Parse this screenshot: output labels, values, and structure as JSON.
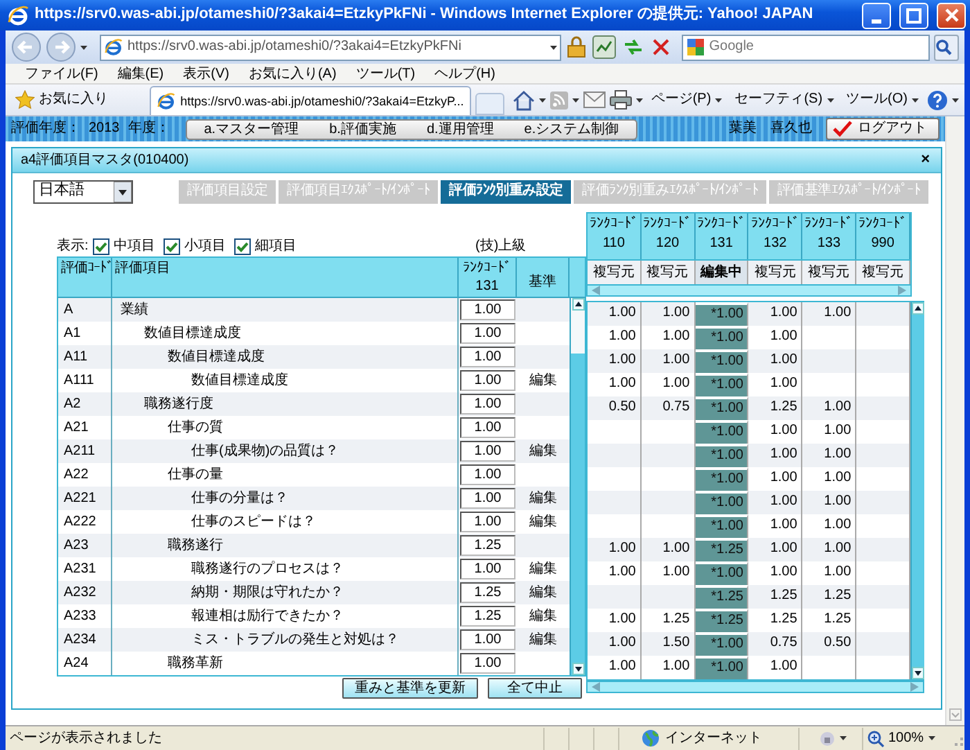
{
  "window": {
    "title": "https://srv0.was-abi.jp/otameshi0/?3akai4=EtzkyPkFNi - Windows Internet Explorer の提供元: Yahoo! JAPAN"
  },
  "address_bar": {
    "url": "https://srv0.was-abi.jp/otameshi0/?3akai4=EtzkyPkFNi"
  },
  "search": {
    "placeholder": "Google"
  },
  "menu": [
    "ファイル(F)",
    "編集(E)",
    "表示(V)",
    "お気に入り(A)",
    "ツール(T)",
    "ヘルプ(H)"
  ],
  "favorites": {
    "label": "お気に入り"
  },
  "browser_tabs": [
    {
      "label": "https://srv0.was-abi.jp/otameshi0/?3akai4=EtzkyP...",
      "selected": true
    }
  ],
  "command_bar": [
    "ページ(P)",
    "セーフティ(S)",
    "ツール(O)"
  ],
  "app_header": {
    "year_label": "評価年度：",
    "year": "2013",
    "year_suffix": "年度：",
    "nav": [
      "a.マスター管理",
      "b.評価実施",
      "d.運用管理",
      "e.システム制御"
    ],
    "user": "葉美　喜久也",
    "logout": "ログアウト"
  },
  "dialog": {
    "title": "a4評価項目マスタ(010400)",
    "close": "×",
    "language": "日本語",
    "tabs": [
      {
        "label": "評価項目設定",
        "selected": false
      },
      {
        "label": "評価項目ｴｸｽﾎﾟｰﾄ/ｲﾝﾎﾟｰﾄ",
        "selected": false
      },
      {
        "label": "評価ﾗﾝｸ別重み設定",
        "selected": true
      },
      {
        "label": "評価ﾗﾝｸ別重みｴｸｽﾎﾟｰﾄ/ｲﾝﾎﾟｰﾄ",
        "selected": false
      },
      {
        "label": "評価基準ｴｸｽﾎﾟｰﾄ/ｲﾝﾎﾟｰﾄ",
        "selected": false
      }
    ],
    "display_label": "表示:",
    "filters": [
      {
        "label": "中項目",
        "checked": true
      },
      {
        "label": "小項目",
        "checked": true
      },
      {
        "label": "細項目",
        "checked": true
      }
    ],
    "grade": "(技)上級",
    "columns": {
      "code": "評価ｺｰﾄﾞ",
      "item": "評価項目",
      "rank_label": "ﾗﾝｸｺｰﾄﾞ",
      "rank": "131",
      "criteria": "基準"
    },
    "rank_columns": [
      {
        "label": "ﾗﾝｸｺｰﾄﾞ",
        "code": "110",
        "status": "複写元",
        "selected": false
      },
      {
        "label": "ﾗﾝｸｺｰﾄﾞ",
        "code": "120",
        "status": "複写元",
        "selected": false
      },
      {
        "label": "ﾗﾝｸｺｰﾄﾞ",
        "code": "131",
        "status": "編集中",
        "selected": true
      },
      {
        "label": "ﾗﾝｸｺｰﾄﾞ",
        "code": "132",
        "status": "複写元",
        "selected": false
      },
      {
        "label": "ﾗﾝｸｺｰﾄﾞ",
        "code": "133",
        "status": "複写元",
        "selected": false
      },
      {
        "label": "ﾗﾝｸｺｰﾄﾞ",
        "code": "990",
        "status": "複写元",
        "selected": false
      }
    ],
    "items": [
      {
        "code": "A",
        "name": "業績",
        "weight": "1.00",
        "values": [
          {
            "kind": "value",
            "value": "1.00"
          },
          {
            "kind": "value",
            "value": "1.00"
          },
          {
            "kind": "value",
            "value": "*1.00"
          },
          {
            "kind": "value",
            "value": "1.00"
          },
          {
            "kind": "value",
            "value": "1.00"
          },
          {
            "kind": "blank"
          }
        ],
        "children": [
          {
            "code": "A1",
            "name": "数値目標達成度",
            "weight": "1.00",
            "values": [
              {
                "kind": "value",
                "value": "1.00"
              },
              {
                "kind": "value",
                "value": "1.00"
              },
              {
                "kind": "value",
                "value": "*1.00"
              },
              {
                "kind": "value",
                "value": "1.00"
              },
              {
                "kind": "blank"
              },
              {
                "kind": "blank"
              }
            ],
            "children": [
              {
                "code": "A11",
                "name": "数値目標達成度",
                "weight": "1.00",
                "values": [
                  {
                    "kind": "value",
                    "value": "1.00"
                  },
                  {
                    "kind": "value",
                    "value": "1.00"
                  },
                  {
                    "kind": "value",
                    "value": "*1.00"
                  },
                  {
                    "kind": "value",
                    "value": "1.00"
                  },
                  {
                    "kind": "blank"
                  },
                  {
                    "kind": "blank"
                  }
                ],
                "children": [
                  {
                    "code": "A111",
                    "name": "数値目標達成度",
                    "weight": "1.00",
                    "criteria": "編集",
                    "values": [
                      {
                        "kind": "value",
                        "value": "1.00"
                      },
                      {
                        "kind": "value",
                        "value": "1.00"
                      },
                      {
                        "kind": "value",
                        "value": "*1.00"
                      },
                      {
                        "kind": "value",
                        "value": "1.00"
                      },
                      {
                        "kind": "blank"
                      },
                      {
                        "kind": "blank"
                      }
                    ]
                  }
                ]
              }
            ]
          },
          {
            "code": "A2",
            "name": "職務遂行度",
            "weight": "1.00",
            "values": [
              {
                "kind": "value",
                "value": "0.50"
              },
              {
                "kind": "value",
                "value": "0.75"
              },
              {
                "kind": "value",
                "value": "*1.00"
              },
              {
                "kind": "value",
                "value": "1.25"
              },
              {
                "kind": "value",
                "value": "1.00"
              },
              {
                "kind": "blank"
              }
            ],
            "children": [
              {
                "code": "A21",
                "name": "仕事の質",
                "weight": "1.00",
                "values": [
                  {
                    "kind": "blank"
                  },
                  {
                    "kind": "blank"
                  },
                  {
                    "kind": "value",
                    "value": "*1.00"
                  },
                  {
                    "kind": "value",
                    "value": "1.00"
                  },
                  {
                    "kind": "value",
                    "value": "1.00"
                  },
                  {
                    "kind": "blank"
                  }
                ],
                "children": [
                  {
                    "code": "A211",
                    "name": "仕事(成果物)の品質は？",
                    "weight": "1.00",
                    "criteria": "編集",
                    "values": [
                      {
                        "kind": "blank"
                      },
                      {
                        "kind": "blank"
                      },
                      {
                        "kind": "value",
                        "value": "*1.00"
                      },
                      {
                        "kind": "value",
                        "value": "1.00"
                      },
                      {
                        "kind": "value",
                        "value": "1.00"
                      },
                      {
                        "kind": "blank"
                      }
                    ]
                  }
                ]
              },
              {
                "code": "A22",
                "name": "仕事の量",
                "weight": "1.00",
                "values": [
                  {
                    "kind": "blank"
                  },
                  {
                    "kind": "blank"
                  },
                  {
                    "kind": "value",
                    "value": "*1.00"
                  },
                  {
                    "kind": "value",
                    "value": "1.00"
                  },
                  {
                    "kind": "value",
                    "value": "1.00"
                  },
                  {
                    "kind": "blank"
                  }
                ],
                "children": [
                  {
                    "code": "A221",
                    "name": "仕事の分量は？",
                    "weight": "1.00",
                    "criteria": "編集",
                    "values": [
                      {
                        "kind": "blank"
                      },
                      {
                        "kind": "blank"
                      },
                      {
                        "kind": "value",
                        "value": "*1.00"
                      },
                      {
                        "kind": "value",
                        "value": "1.00"
                      },
                      {
                        "kind": "value",
                        "value": "1.00"
                      },
                      {
                        "kind": "blank"
                      }
                    ]
                  },
                  {
                    "code": "A222",
                    "name": "仕事のスピードは？",
                    "weight": "1.00",
                    "criteria": "編集",
                    "values": [
                      {
                        "kind": "blank"
                      },
                      {
                        "kind": "blank"
                      },
                      {
                        "kind": "value",
                        "value": "*1.00"
                      },
                      {
                        "kind": "value",
                        "value": "1.00"
                      },
                      {
                        "kind": "value",
                        "value": "1.00"
                      },
                      {
                        "kind": "blank"
                      }
                    ]
                  }
                ]
              },
              {
                "code": "A23",
                "name": "職務遂行",
                "weight": "1.25",
                "values": [
                  {
                    "kind": "value",
                    "value": "1.00"
                  },
                  {
                    "kind": "value",
                    "value": "1.00"
                  },
                  {
                    "kind": "value",
                    "value": "*1.25"
                  },
                  {
                    "kind": "value",
                    "value": "1.00"
                  },
                  {
                    "kind": "value",
                    "value": "1.00"
                  },
                  {
                    "kind": "blank"
                  }
                ],
                "children": [
                  {
                    "code": "A231",
                    "name": "職務遂行のプロセスは？",
                    "weight": "1.00",
                    "criteria": "編集",
                    "values": [
                      {
                        "kind": "value",
                        "value": "1.00"
                      },
                      {
                        "kind": "value",
                        "value": "1.00"
                      },
                      {
                        "kind": "value",
                        "value": "*1.00"
                      },
                      {
                        "kind": "value",
                        "value": "1.00"
                      },
                      {
                        "kind": "value",
                        "value": "1.00"
                      },
                      {
                        "kind": "blank"
                      }
                    ]
                  },
                  {
                    "code": "A232",
                    "name": "納期・期限は守れたか？",
                    "weight": "1.25",
                    "criteria": "編集",
                    "values": [
                      {
                        "kind": "blank"
                      },
                      {
                        "kind": "blank"
                      },
                      {
                        "kind": "value",
                        "value": "*1.25"
                      },
                      {
                        "kind": "value",
                        "value": "1.25"
                      },
                      {
                        "kind": "value",
                        "value": "1.25"
                      },
                      {
                        "kind": "blank"
                      }
                    ]
                  },
                  {
                    "code": "A233",
                    "name": "報連相は励行できたか？",
                    "weight": "1.25",
                    "criteria": "編集",
                    "values": [
                      {
                        "kind": "value",
                        "value": "1.00"
                      },
                      {
                        "kind": "value",
                        "value": "1.25"
                      },
                      {
                        "kind": "value",
                        "value": "*1.25"
                      },
                      {
                        "kind": "value",
                        "value": "1.25"
                      },
                      {
                        "kind": "value",
                        "value": "1.25"
                      },
                      {
                        "kind": "blank"
                      }
                    ]
                  },
                  {
                    "code": "A234",
                    "name": "ミス・トラブルの発生と対処は？",
                    "weight": "1.00",
                    "criteria": "編集",
                    "values": [
                      {
                        "kind": "value",
                        "value": "1.00"
                      },
                      {
                        "kind": "value",
                        "value": "1.50"
                      },
                      {
                        "kind": "value",
                        "value": "*1.00"
                      },
                      {
                        "kind": "value",
                        "value": "0.75"
                      },
                      {
                        "kind": "value",
                        "value": "0.50"
                      },
                      {
                        "kind": "blank"
                      }
                    ]
                  }
                ]
              },
              {
                "code": "A24",
                "name": "職務革新",
                "weight": "1.00",
                "values": [
                  {
                    "kind": "value",
                    "value": "1.00"
                  },
                  {
                    "kind": "value",
                    "value": "1.00"
                  },
                  {
                    "kind": "value",
                    "value": "*1.00"
                  },
                  {
                    "kind": "value",
                    "value": "1.00"
                  },
                  {
                    "kind": "blank"
                  },
                  {
                    "kind": "blank"
                  }
                ]
              }
            ]
          }
        ]
      }
    ],
    "buttons": [
      "重みと基準を更新",
      "全て中止"
    ]
  },
  "status_bar": {
    "text": "ページが表示されました",
    "zone": "インターネット",
    "zoom": "100%"
  }
}
